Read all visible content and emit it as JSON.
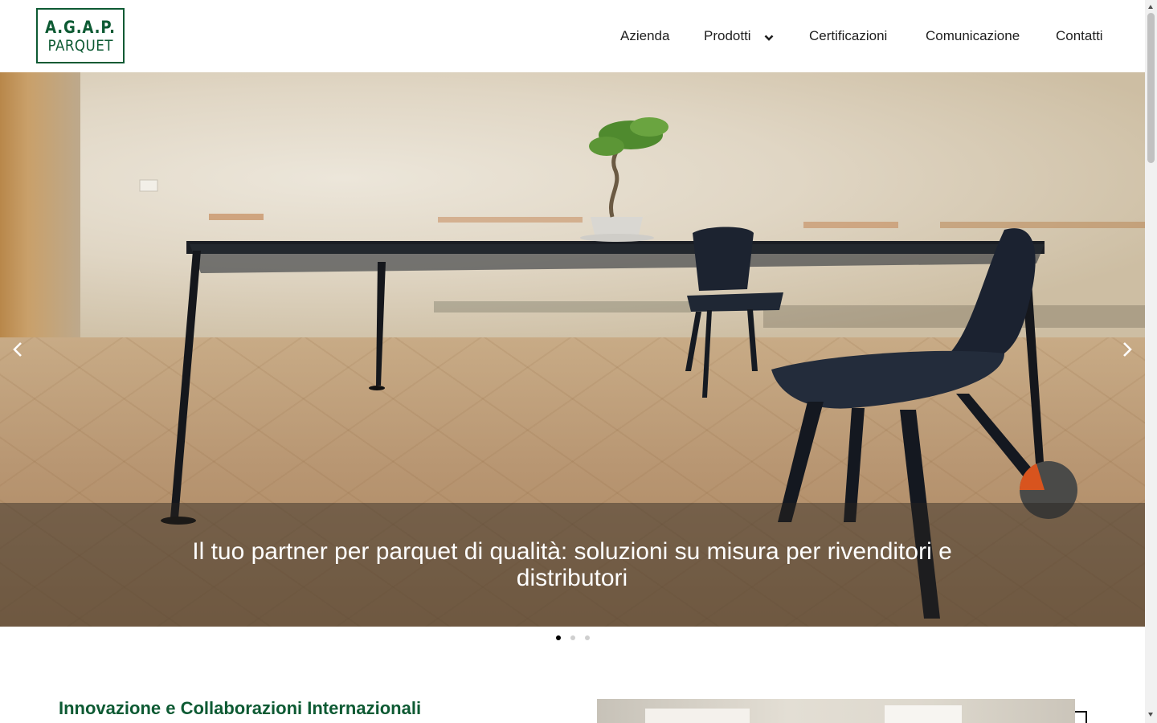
{
  "brand": {
    "logo_line1": "A.G.A.P.",
    "logo_line2": "PARQUET",
    "brand_color": "#0d5a33"
  },
  "nav": {
    "items": [
      {
        "label": "Azienda"
      },
      {
        "label": "Prodotti",
        "has_dropdown": true,
        "icon": "chevron-down-icon"
      },
      {
        "label": "Certificazioni"
      },
      {
        "label": "Comunicazione"
      },
      {
        "label": "Contatti"
      }
    ]
  },
  "hero": {
    "caption": "Il tuo partner per parquet di qualità: soluzioni su misura per rivenditori e distributori",
    "prev_icon": "chevron-left-icon",
    "next_icon": "chevron-right-icon",
    "slides_total": 3,
    "active_slide": 1
  },
  "section": {
    "title": "Innovazione e Collaborazioni Internazionali"
  }
}
